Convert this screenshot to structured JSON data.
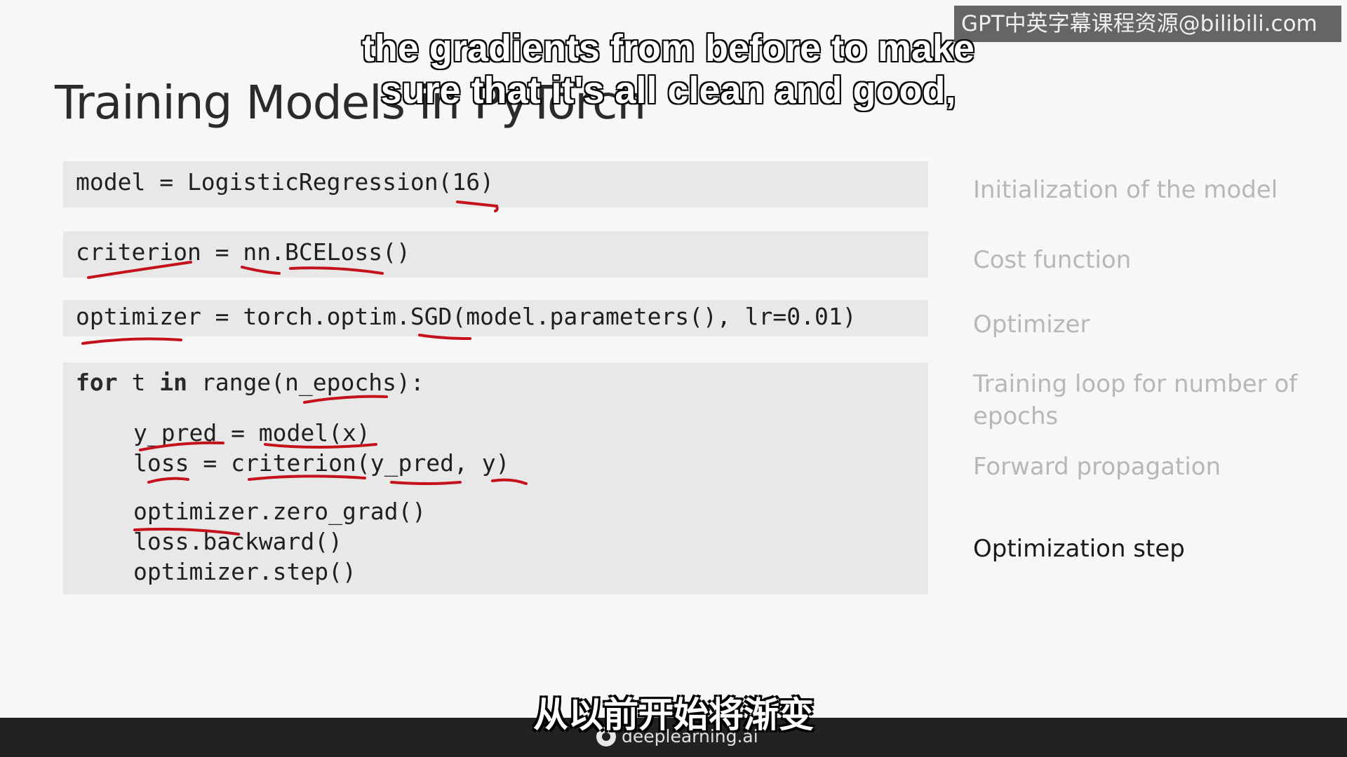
{
  "slide": {
    "title": "Training Models in PyTorch"
  },
  "code": {
    "line_model": "model = LogisticRegression(16)",
    "line_criterion": "criterion = nn.BCELoss()",
    "line_optimizer": "optimizer = torch.optim.SGD(model.parameters(), lr=0.01)",
    "loop_for": "for",
    "loop_t": " t ",
    "loop_in": "in",
    "loop_rest": " range(n_epochs):",
    "line_ypred": "y_pred = model(x)",
    "line_loss": "loss = criterion(y_pred, y)",
    "line_zero_grad": "optimizer.zero_grad()",
    "line_backward": "loss.backward()",
    "line_step": "optimizer.step()"
  },
  "side_labels": {
    "init": "Initialization of the model",
    "cost": "Cost function",
    "optimizer": "Optimizer",
    "loop": "Training loop for number of epochs",
    "forward": "Forward propagation",
    "opt_step": "Optimization step"
  },
  "subtitles": {
    "en_line1": "the gradients from before to make",
    "en_line2": "sure that it's all clean and good,",
    "zh": "从以前开始将渐变"
  },
  "watermark": {
    "text": "GPT中英字幕课程资源@bilibili.com"
  },
  "footer": {
    "brand": "deeplearning.ai"
  },
  "colors": {
    "annotation": "#c4111c",
    "active_label": "#1a1a1a",
    "inactive_label": "#b7b7b7"
  }
}
